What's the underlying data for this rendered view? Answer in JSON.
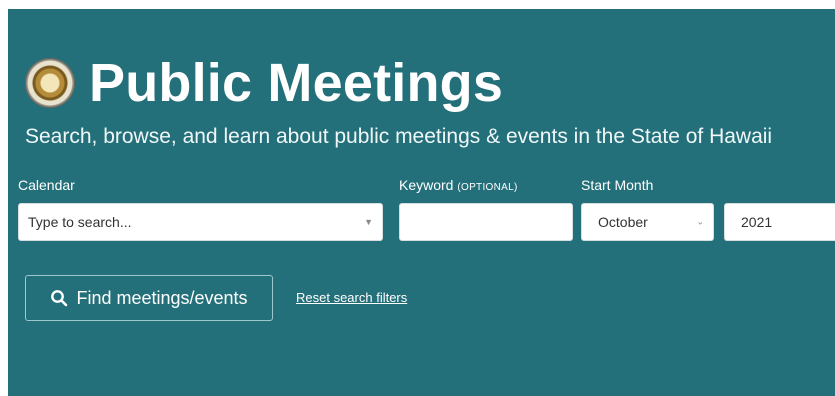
{
  "header": {
    "title": "Public Meetings",
    "subtitle": "Search, browse, and learn about public meetings & events in the State of Hawaii"
  },
  "search": {
    "calendar_label": "Calendar",
    "calendar_placeholder": "Type to search...",
    "keyword_label": "Keyword",
    "keyword_optional": "(OPTIONAL)",
    "keyword_value": "",
    "start_month_label": "Start Month",
    "month_value": "October",
    "year_value": "2021"
  },
  "actions": {
    "find_label": "Find meetings/events",
    "reset_label": "Reset search filters"
  },
  "colors": {
    "panel_bg": "#23707a",
    "text": "#ffffff"
  },
  "icons": {
    "seal": "hawaii-state-seal-icon",
    "search": "search-icon",
    "dropdown": "chevron-down-icon"
  }
}
